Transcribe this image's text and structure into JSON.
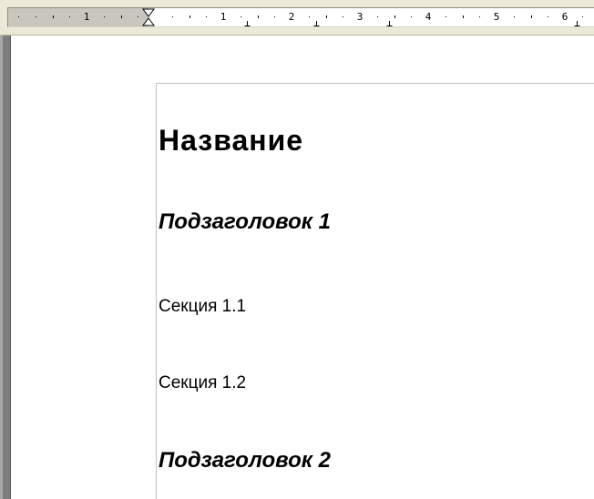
{
  "ruler": {
    "left_margin_numbers": [
      "1"
    ],
    "page_numbers": [
      "1",
      "2",
      "3",
      "4",
      "5",
      "6"
    ],
    "colors": {
      "margin": "#c8c6bd",
      "ruler": "#ffffff",
      "background": "#ece9d8"
    }
  },
  "document": {
    "title": "Название",
    "subheading_1": "Подзаголовок 1",
    "section_1_1": "Секция 1.1",
    "section_1_2": "Секция 1.2",
    "subheading_2": "Подзаголовок 2"
  }
}
